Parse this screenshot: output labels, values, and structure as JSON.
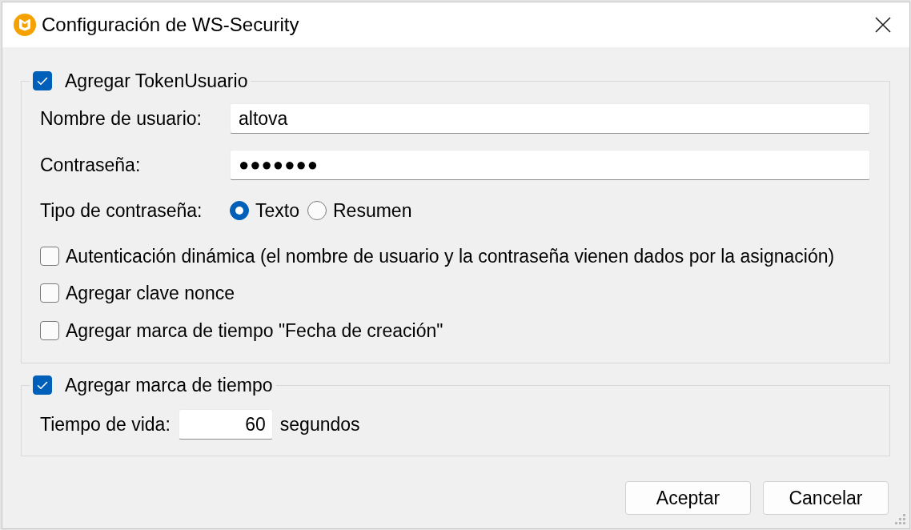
{
  "window": {
    "title": "Configuración de WS-Security"
  },
  "user_token": {
    "label": "Agregar TokenUsuario",
    "checked": true,
    "fields": [
      {
        "kind": "text",
        "label": "Nombre de usuario:",
        "value": "altova"
      },
      {
        "kind": "password",
        "label": "Contraseña:",
        "value": "●●●●●●●"
      }
    ],
    "password_type": {
      "label": "Tipo de contraseña:",
      "options": [
        {
          "label": "Texto",
          "selected": true
        },
        {
          "label": "Resumen",
          "selected": false
        }
      ]
    },
    "options": [
      {
        "label": "Autenticación dinámica (el nombre de usuario y la contraseña vienen dados por la asignación)",
        "checked": false
      },
      {
        "label": "Agregar clave nonce",
        "checked": false
      },
      {
        "label": "Agregar marca de tiempo \"Fecha de creación\"",
        "checked": false
      }
    ]
  },
  "timestamp": {
    "label": "Agregar marca de tiempo",
    "checked": true,
    "lifetime": {
      "label": "Tiempo de vida:",
      "value": "60",
      "unit": "segundos"
    }
  },
  "buttons": [
    {
      "label": "Aceptar"
    },
    {
      "label": "Cancelar"
    }
  ]
}
